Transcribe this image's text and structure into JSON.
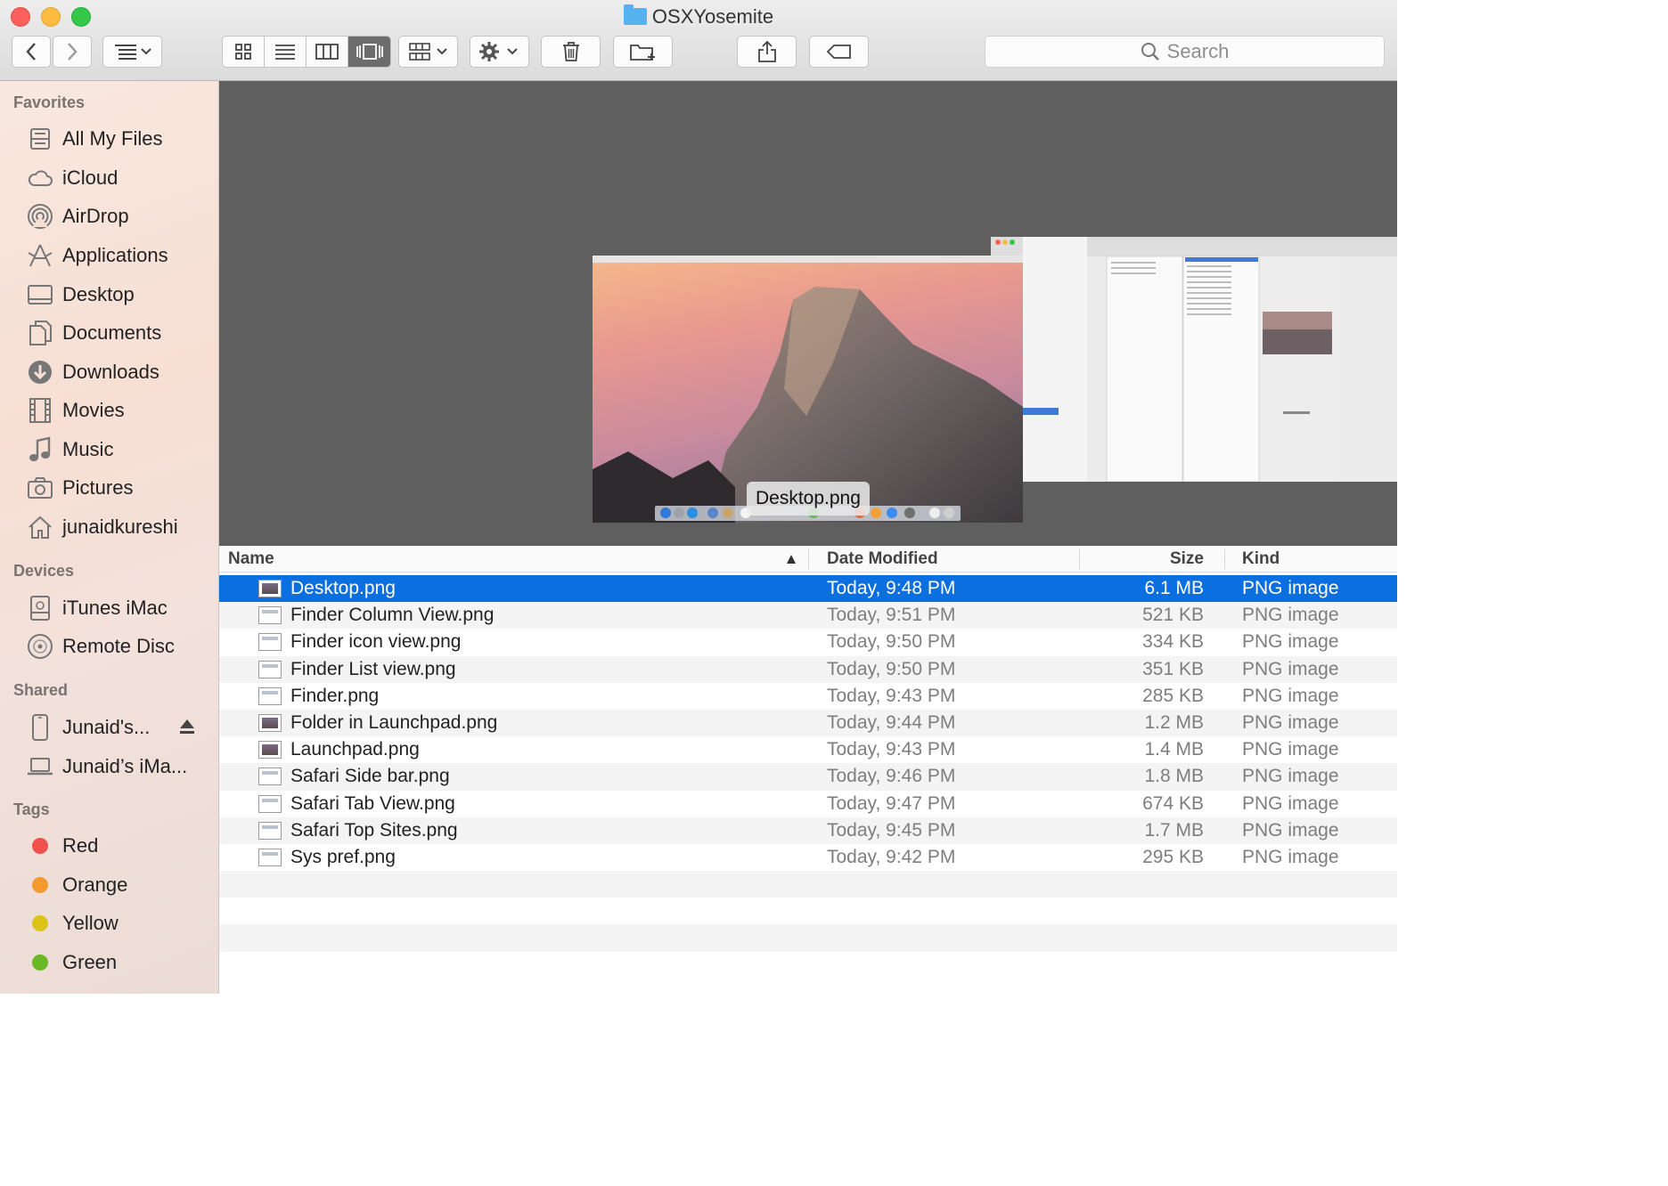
{
  "window": {
    "title": "OSXYosemite"
  },
  "toolbar": {
    "back_icon": "chevron-left-icon",
    "forward_icon": "chevron-right-icon",
    "arrange_icon": "arrange-icon",
    "view_icons": [
      "icon-view-icon",
      "list-view-icon",
      "column-view-icon",
      "cover-flow-icon"
    ],
    "active_view": 3,
    "group_icon": "group-icon",
    "action_icon": "gear-icon",
    "trash_icon": "trash-icon",
    "new_folder_icon": "new-folder-icon",
    "share_icon": "share-icon",
    "tag_icon": "tag-icon",
    "search_placeholder": "Search"
  },
  "sidebar": {
    "favorites_header": "Favorites",
    "favorites": [
      {
        "label": "All My Files",
        "icon": "all-files-icon"
      },
      {
        "label": "iCloud",
        "icon": "cloud-icon"
      },
      {
        "label": "AirDrop",
        "icon": "airdrop-icon"
      },
      {
        "label": "Applications",
        "icon": "applications-icon"
      },
      {
        "label": "Desktop",
        "icon": "desktop-icon"
      },
      {
        "label": "Documents",
        "icon": "documents-icon"
      },
      {
        "label": "Downloads",
        "icon": "downloads-icon"
      },
      {
        "label": "Movies",
        "icon": "movies-icon"
      },
      {
        "label": "Music",
        "icon": "music-icon"
      },
      {
        "label": "Pictures",
        "icon": "pictures-icon"
      },
      {
        "label": "junaidkureshi",
        "icon": "home-icon"
      }
    ],
    "devices_header": "Devices",
    "devices": [
      {
        "label": "iTunes iMac",
        "icon": "drive-icon"
      },
      {
        "label": "Remote Disc",
        "icon": "disc-icon"
      }
    ],
    "shared_header": "Shared",
    "shared": [
      {
        "label": "Junaid's...",
        "icon": "iphone-icon",
        "eject": "eject-icon"
      },
      {
        "label": "Junaid’s iMa...",
        "icon": "laptop-icon"
      }
    ],
    "tags_header": "Tags",
    "tags": [
      {
        "label": "Red",
        "color": "#f2504d"
      },
      {
        "label": "Orange",
        "color": "#f59a2f"
      },
      {
        "label": "Yellow",
        "color": "#dcc31a"
      },
      {
        "label": "Green",
        "color": "#6bb825"
      }
    ]
  },
  "coverflow": {
    "selected_label": "Desktop.png"
  },
  "list": {
    "columns": {
      "name": "Name",
      "date": "Date Modified",
      "size": "Size",
      "kind": "Kind"
    },
    "sort_icon": "sort-ascending-icon",
    "rows": [
      {
        "name": "Desktop.png",
        "date": "Today, 9:48 PM",
        "size": "6.1 MB",
        "kind": "PNG image",
        "selected": true,
        "thumb": "dark"
      },
      {
        "name": "Finder Column View.png",
        "date": "Today, 9:51 PM",
        "size": "521 KB",
        "kind": "PNG image",
        "thumb": "light"
      },
      {
        "name": "Finder icon view.png",
        "date": "Today, 9:50 PM",
        "size": "334 KB",
        "kind": "PNG image",
        "thumb": "light"
      },
      {
        "name": "Finder List view.png",
        "date": "Today, 9:50 PM",
        "size": "351 KB",
        "kind": "PNG image",
        "thumb": "light"
      },
      {
        "name": "Finder.png",
        "date": "Today, 9:43 PM",
        "size": "285 KB",
        "kind": "PNG image",
        "thumb": "light"
      },
      {
        "name": "Folder in Launchpad.png",
        "date": "Today, 9:44 PM",
        "size": "1.2 MB",
        "kind": "PNG image",
        "thumb": "dark"
      },
      {
        "name": "Launchpad.png",
        "date": "Today, 9:43 PM",
        "size": "1.4 MB",
        "kind": "PNG image",
        "thumb": "dark"
      },
      {
        "name": "Safari Side bar.png",
        "date": "Today, 9:46 PM",
        "size": "1.8 MB",
        "kind": "PNG image",
        "thumb": "light"
      },
      {
        "name": "Safari Tab View.png",
        "date": "Today, 9:47 PM",
        "size": "674 KB",
        "kind": "PNG image",
        "thumb": "light"
      },
      {
        "name": "Safari Top Sites.png",
        "date": "Today, 9:45 PM",
        "size": "1.7 MB",
        "kind": "PNG image",
        "thumb": "light"
      },
      {
        "name": "Sys pref.png",
        "date": "Today, 9:42 PM",
        "size": "295 KB",
        "kind": "PNG image",
        "thumb": "light"
      }
    ]
  }
}
